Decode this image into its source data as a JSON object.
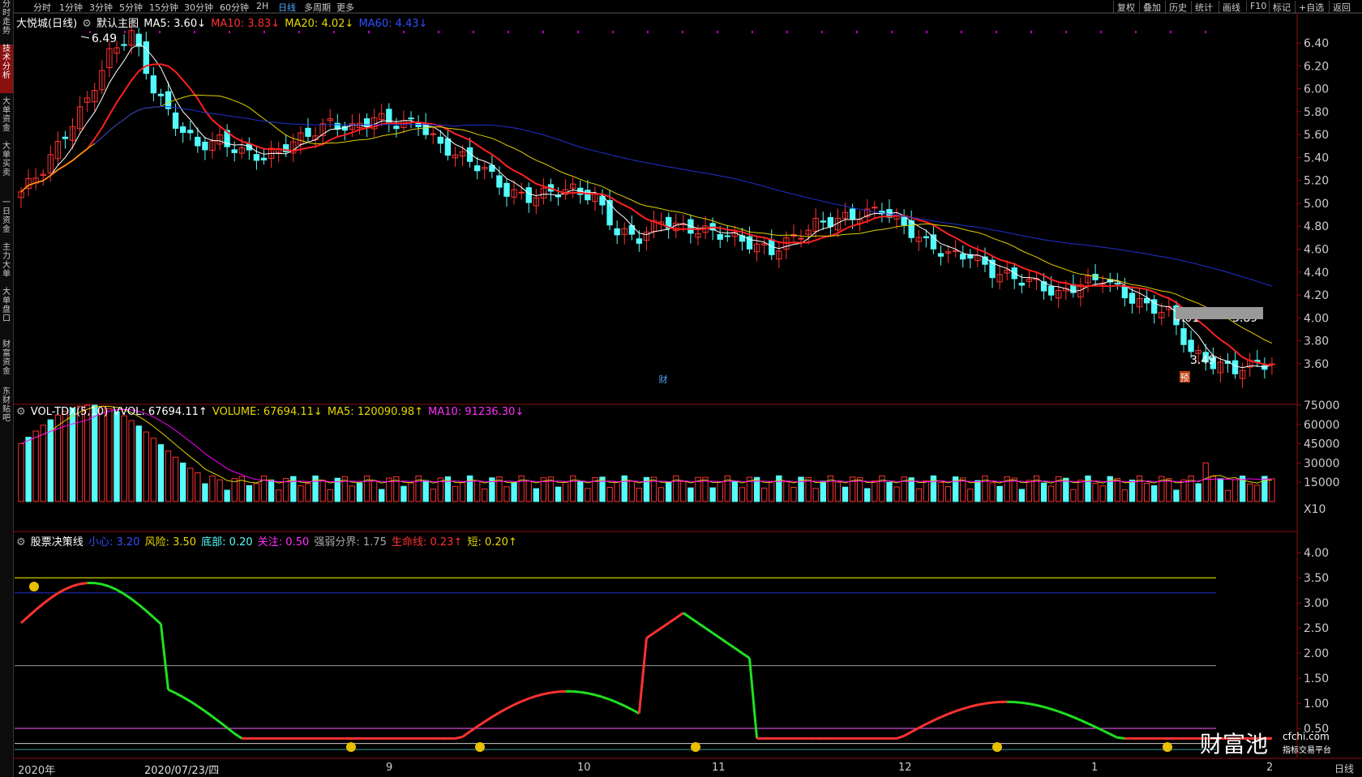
{
  "left_tabs": [
    "分时走势",
    "技术分析",
    "大单资金",
    "大单买卖",
    "一日资金",
    "主力大单",
    "大单盘口",
    "财富资金",
    "东财贴吧"
  ],
  "topbar": {
    "periods": [
      "分时",
      "1分钟",
      "3分钟",
      "5分钟",
      "15分钟",
      "30分钟",
      "60分钟",
      "2H",
      "日线",
      "多周期",
      "更多"
    ],
    "selected": "日线",
    "right_menu": [
      "复权",
      "叠加",
      "历史",
      "统计",
      "画线",
      "F10",
      "标记",
      "+自选",
      "返回"
    ]
  },
  "main_legend": {
    "stock": "大悦城(日线)",
    "template": "默认主图",
    "ma5": "MA5: 3.60↓",
    "ma10": "MA10: 3.83↓",
    "ma20": "MA20: 4.02↓",
    "ma60": "MA60: 4.43↓"
  },
  "price_annotations": {
    "high": "6.49",
    "low": "3.49",
    "mark1": "4.01",
    "mark2": "3.89",
    "fin_tag": "财",
    "pre_tag": "预"
  },
  "vol_legend": {
    "name": "VOL-TDX(5,10)",
    "vvol": "VVOL: 67694.11↑",
    "volume": "VOLUME: 67694.11↓",
    "ma5": "MA5: 120090.98↑",
    "ma10": "MA10: 91236.30↓",
    "unit": "X10"
  },
  "ind_legend": {
    "name": "股票决策线",
    "xinxi": "小心: 3.20",
    "risk": "风险: 3.50",
    "bottom": "底部: 0.20",
    "focus": "关注: 0.50",
    "boundary": "强弱分界: 1.75",
    "life": "生命线: 0.23↑",
    "short": "短: 0.20↑"
  },
  "axes": {
    "price_ticks": [
      "6.40",
      "6.20",
      "6.00",
      "5.80",
      "5.60",
      "5.40",
      "5.20",
      "5.00",
      "4.80",
      "4.60",
      "4.40",
      "4.20",
      "4.00",
      "3.80",
      "3.60"
    ],
    "vol_ticks": [
      "75000",
      "60000",
      "45000",
      "30000",
      "15000"
    ],
    "ind_ticks": [
      "4.00",
      "3.50",
      "3.00",
      "2.50",
      "2.00",
      "1.50",
      "1.00",
      "0.50"
    ],
    "date_labels": [
      "2020年",
      "2020/07/23/四",
      "9",
      "10",
      "11",
      "12",
      "1",
      "2"
    ],
    "period_label": "日线"
  },
  "watermark": {
    "brand": "财富池",
    "url": "cfchi.com",
    "tagline": "指标交易平台"
  },
  "colors": {
    "up": "#ff3232",
    "down": "#54fcfc",
    "ma5": "#ffffff",
    "ma10": "#ff2020",
    "ma20": "#e0d000",
    "ma60": "#2030d0",
    "purple": "#ff00ff",
    "yellow": "#ffff00"
  },
  "chart_data": {
    "type": "candlestick",
    "price_range": [
      3.45,
      6.5
    ],
    "close_series_sampled": [
      5.1,
      5.3,
      5.6,
      5.9,
      6.3,
      6.49,
      6.0,
      5.7,
      5.5,
      5.55,
      5.45,
      5.4,
      5.5,
      5.6,
      5.7,
      5.65,
      5.75,
      5.7,
      5.7,
      5.5,
      5.4,
      5.3,
      5.1,
      5.05,
      5.1,
      5.12,
      5.05,
      4.75,
      4.7,
      4.85,
      4.78,
      4.76,
      4.72,
      4.65,
      4.58,
      4.7,
      4.82,
      4.86,
      4.9,
      4.95,
      4.8,
      4.65,
      4.55,
      4.55,
      4.4,
      4.35,
      4.3,
      4.2,
      4.3,
      4.35,
      4.2,
      4.1,
      4.05,
      3.7,
      3.6,
      3.55,
      3.6
    ],
    "volume_ticks": [
      75000,
      60000,
      45000,
      30000,
      15000
    ],
    "indicator_levels": {
      "risk": 3.5,
      "xinxi": 3.2,
      "boundary": 1.75,
      "focus": 0.5,
      "bottom": 0.2
    }
  }
}
